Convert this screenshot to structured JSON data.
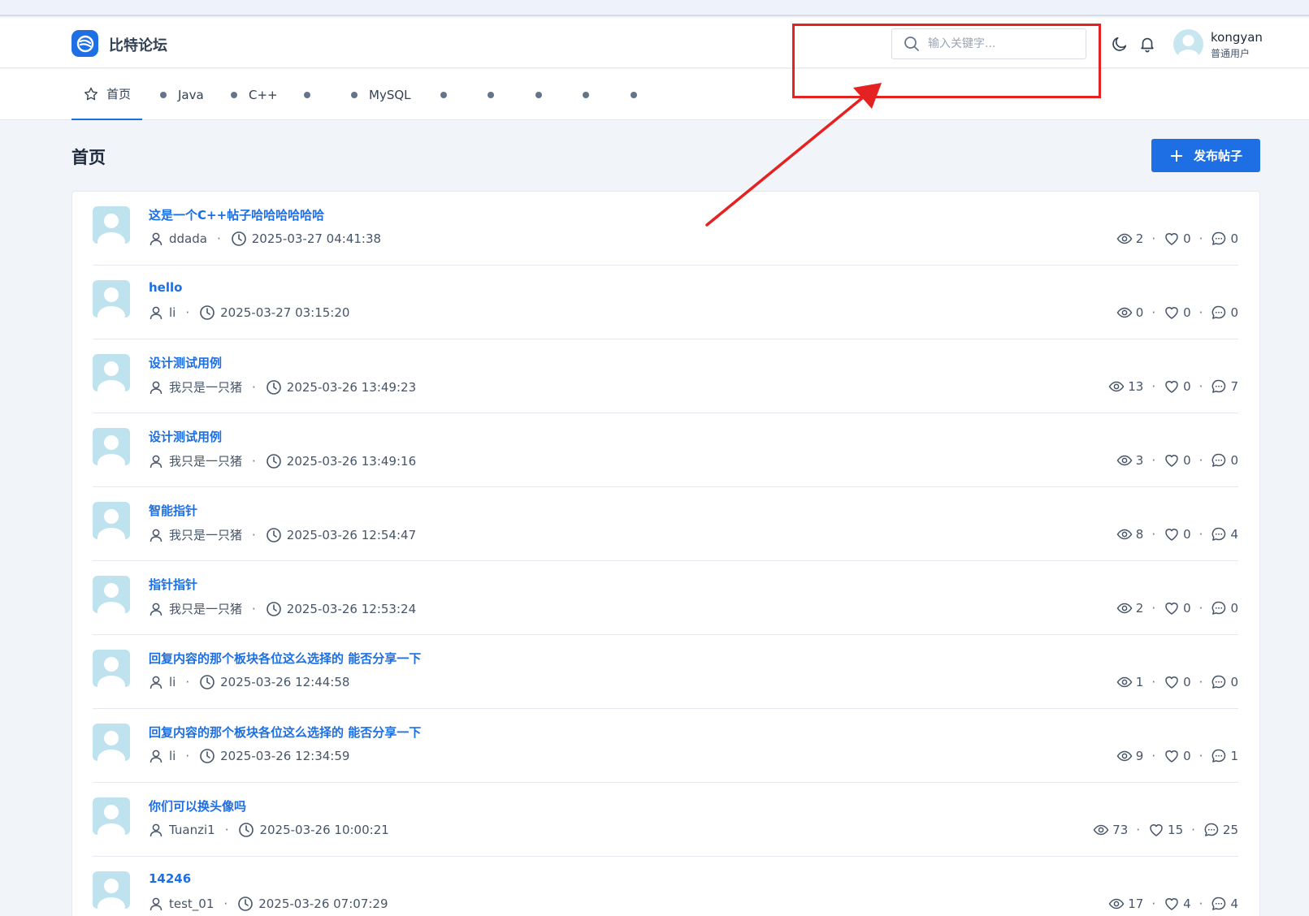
{
  "header": {
    "brand": "比特论坛",
    "search_placeholder": "输入关键字...",
    "user_name": "kongyan",
    "user_role": "普通用户"
  },
  "nav": {
    "items": [
      {
        "label": "首页",
        "active": true
      },
      {
        "label": "Java"
      },
      {
        "label": "C++"
      },
      {
        "label": ""
      },
      {
        "label": "MySQL"
      },
      {
        "label": ""
      },
      {
        "label": ""
      },
      {
        "label": ""
      },
      {
        "label": ""
      },
      {
        "label": ""
      }
    ]
  },
  "page": {
    "title": "首页",
    "publish_label": "发布帖子"
  },
  "posts": [
    {
      "title": "这是一个C++帖子哈哈哈哈哈哈",
      "author": "ddada",
      "time": "2025-03-27 04:41:38",
      "views": "2",
      "likes": "0",
      "comments": "0"
    },
    {
      "title": "hello",
      "author": "li",
      "time": "2025-03-27 03:15:20",
      "views": "0",
      "likes": "0",
      "comments": "0"
    },
    {
      "title": "设计测试用例",
      "author": "我只是一只猪",
      "time": "2025-03-26 13:49:23",
      "views": "13",
      "likes": "0",
      "comments": "7"
    },
    {
      "title": "设计测试用例",
      "author": "我只是一只猪",
      "time": "2025-03-26 13:49:16",
      "views": "3",
      "likes": "0",
      "comments": "0"
    },
    {
      "title": "智能指针",
      "author": "我只是一只猪",
      "time": "2025-03-26 12:54:47",
      "views": "8",
      "likes": "0",
      "comments": "4"
    },
    {
      "title": "指针指针",
      "author": "我只是一只猪",
      "time": "2025-03-26 12:53:24",
      "views": "2",
      "likes": "0",
      "comments": "0"
    },
    {
      "title": "回复内容的那个板块各位这么选择的 能否分享一下",
      "author": "li",
      "time": "2025-03-26 12:44:58",
      "views": "1",
      "likes": "0",
      "comments": "0"
    },
    {
      "title": "回复内容的那个板块各位这么选择的 能否分享一下",
      "author": "li",
      "time": "2025-03-26 12:34:59",
      "views": "9",
      "likes": "0",
      "comments": "1"
    },
    {
      "title": "你们可以换头像吗",
      "author": "Tuanzi1",
      "time": "2025-03-26 10:00:21",
      "views": "73",
      "likes": "15",
      "comments": "25"
    },
    {
      "title": "14246",
      "author": "test_01",
      "time": "2025-03-26 07:07:29",
      "views": "17",
      "likes": "4",
      "comments": "4"
    }
  ],
  "colors": {
    "accent": "#1d6fe3",
    "annotation": "#e52222"
  }
}
